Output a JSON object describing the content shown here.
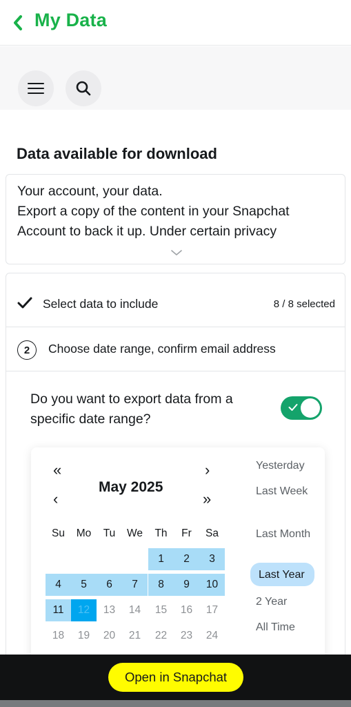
{
  "header": {
    "back_label": "My Data"
  },
  "toolbar": {
    "menu_icon": "hamburger-menu-icon",
    "search_icon": "search-icon"
  },
  "section": {
    "title": "Data available for download"
  },
  "intro": {
    "lines": [
      "Your account, your data.",
      "Export a copy of the content in your Snapchat",
      "Account to back it up. Under certain privacy"
    ]
  },
  "steps": {
    "step1": {
      "label": "Select data to include",
      "count": "8 / 8 selected"
    },
    "step2": {
      "number": "2",
      "label": "Choose date range, confirm email address"
    }
  },
  "date_range": {
    "question": "Do you want to export data from a specific date range?",
    "toggle_on": true,
    "toggle_color": "#14a36b"
  },
  "calendar": {
    "month_label": "May 2025",
    "nav": {
      "prev_year": "«",
      "next_month": "›",
      "prev_month": "‹",
      "next_year": "»"
    },
    "weekdays": [
      "Su",
      "Mo",
      "Tu",
      "We",
      "Th",
      "Fr",
      "Sa"
    ],
    "rows": [
      [
        "",
        "",
        "",
        "",
        "1",
        "2",
        "3"
      ],
      [
        "4",
        "5",
        "6",
        "7",
        "8",
        "9",
        "10"
      ],
      [
        "11",
        "12",
        "13",
        "14",
        "15",
        "16",
        "17"
      ],
      [
        "18",
        "19",
        "20",
        "21",
        "22",
        "23",
        "24"
      ]
    ],
    "selected_days": [
      "1",
      "2",
      "3",
      "4",
      "5",
      "6",
      "7",
      "8",
      "9",
      "10",
      "11"
    ],
    "today": "12",
    "selection_color": "#a8dcf7",
    "today_color": "#00a6ef"
  },
  "presets": {
    "items": [
      "Yesterday",
      "Last Week",
      "Last Month",
      "Last Year",
      "2 Year",
      "All Time"
    ],
    "active": "Last Year",
    "active_color": "#bde1fb"
  },
  "footer": {
    "open_label": "Open in Snapchat",
    "button_color": "#fffc00"
  }
}
